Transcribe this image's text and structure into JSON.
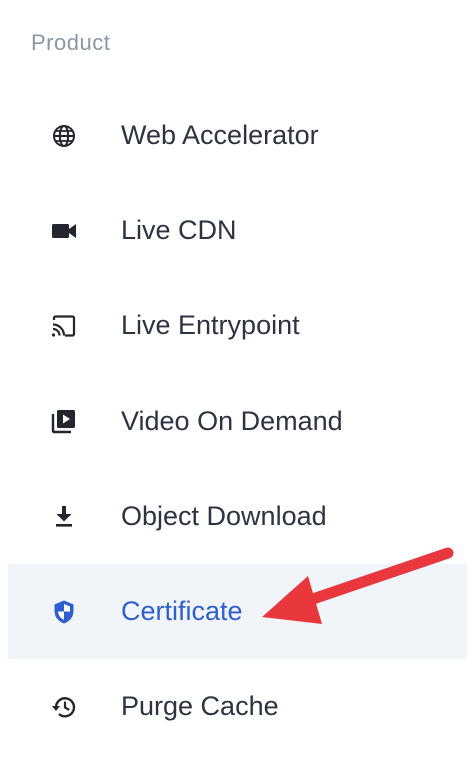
{
  "section": {
    "heading": "Product"
  },
  "menu": {
    "items": [
      {
        "label": "Web Accelerator",
        "icon": "globe-icon",
        "active": false
      },
      {
        "label": "Live CDN",
        "icon": "video-camera-icon",
        "active": false
      },
      {
        "label": "Live Entrypoint",
        "icon": "cast-icon",
        "active": false
      },
      {
        "label": "Video On Demand",
        "icon": "video-library-icon",
        "active": false
      },
      {
        "label": "Object Download",
        "icon": "download-icon",
        "active": false
      },
      {
        "label": "Certificate",
        "icon": "shield-icon",
        "active": true
      },
      {
        "label": "Purge Cache",
        "icon": "history-icon",
        "active": false
      }
    ]
  },
  "colors": {
    "text": "#2d3340",
    "muted": "#8a97a6",
    "active_text": "#2f5fcf",
    "active_bg": "#f1f4f9",
    "annotation": "#e8383d"
  }
}
